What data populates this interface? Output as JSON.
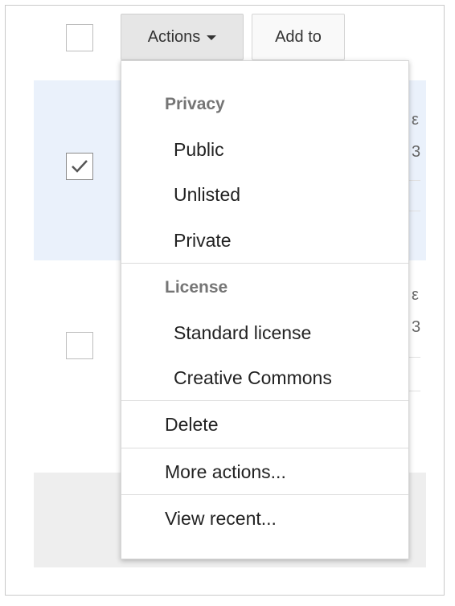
{
  "toolbar": {
    "actions_label": "Actions",
    "addto_label": "Add to"
  },
  "rows": [
    {
      "checked": false
    },
    {
      "checked": true
    },
    {
      "checked": false
    }
  ],
  "background_fragments": [
    "ε",
    "3",
    "ε",
    "3"
  ],
  "menu": {
    "sections": [
      {
        "heading": "Privacy",
        "items": [
          "Public",
          "Unlisted",
          "Private"
        ]
      },
      {
        "heading": "License",
        "items": [
          "Standard license",
          "Creative Commons"
        ]
      }
    ],
    "bottom_items": [
      "Delete",
      "More actions...",
      "View recent..."
    ]
  },
  "colors": {
    "selected_row": "#eaf1fb",
    "gray_row": "#eeeeee",
    "menu_heading": "#757575"
  }
}
